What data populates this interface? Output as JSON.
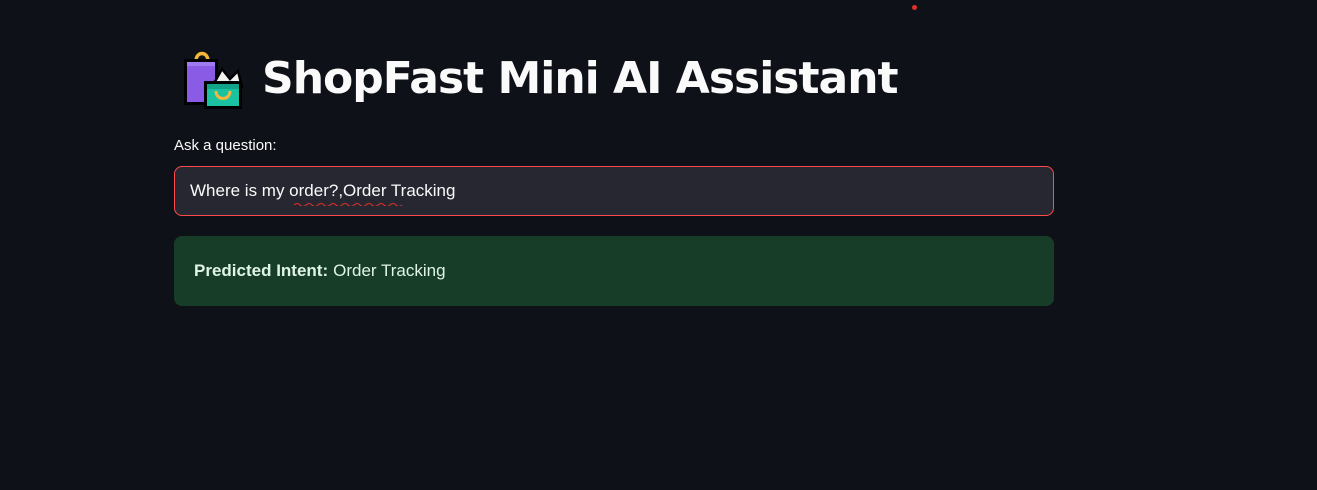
{
  "header": {
    "icon": "shopping-bags-icon",
    "title": "ShopFast Mini AI Assistant"
  },
  "question": {
    "label": "Ask a question:",
    "value": "Where is my order?,Order Tracking"
  },
  "result": {
    "label": "Predicted Intent:",
    "value": "Order Tracking"
  },
  "colors": {
    "background": "#0e1117",
    "input_background": "#262730",
    "input_border_focus": "#ff4b4b",
    "success_background": "#173d28",
    "success_text": "#dff5e6",
    "status_dot": "#e0302a"
  }
}
